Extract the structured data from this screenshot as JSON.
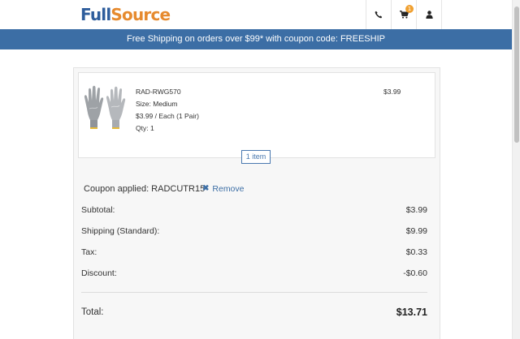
{
  "header": {
    "logo_full": "Full",
    "logo_source": "Source",
    "phone_icon": "phone-icon",
    "cart_icon": "cart-icon",
    "cart_count": "1",
    "user_icon": "user-icon"
  },
  "banner": {
    "text": "Free Shipping on orders over $99* with coupon code: FREESHIP"
  },
  "cart": {
    "item": {
      "sku": "RAD-RWG570",
      "size": "Size: Medium",
      "unit_price": "$3.99 / Each (1 Pair)",
      "qty": "Qty: 1",
      "price": "$3.99"
    },
    "item_count": "1 item",
    "coupon_applied": "Coupon applied: RADCUTR15",
    "remove_label": "Remove",
    "summary": {
      "subtotal_label": "Subtotal:",
      "subtotal_value": "$3.99",
      "shipping_label": "Shipping (Standard):",
      "shipping_value": "$9.99",
      "tax_label": "Tax:",
      "tax_value": "$0.33",
      "discount_label": "Discount:",
      "discount_value": "-$0.60",
      "total_label": "Total:",
      "total_value": "$13.71"
    }
  },
  "colors": {
    "brand_blue": "#3c6ea5",
    "logo_blue": "#2e5d9c",
    "logo_orange": "#e68a2e",
    "badge_orange": "#f0a030"
  }
}
